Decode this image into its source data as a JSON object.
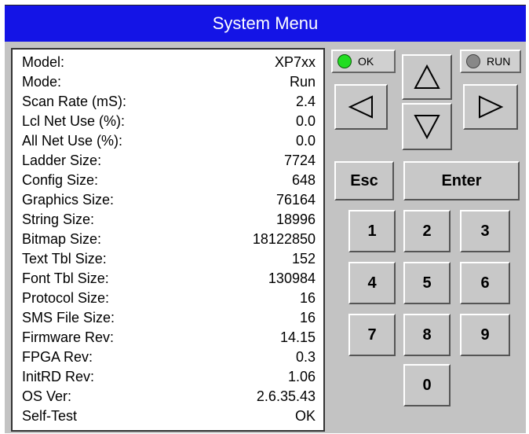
{
  "window": {
    "title": "System Menu"
  },
  "info": {
    "rows": [
      {
        "label": "Model:",
        "value": "XP7xx"
      },
      {
        "label": "Mode:",
        "value": "Run"
      },
      {
        "label": "Scan Rate (mS):",
        "value": "2.4"
      },
      {
        "label": "Lcl Net Use (%):",
        "value": "0.0"
      },
      {
        "label": "All Net Use (%):",
        "value": "0.0"
      },
      {
        "label": "Ladder Size:",
        "value": "7724"
      },
      {
        "label": "Config Size:",
        "value": "648"
      },
      {
        "label": "Graphics Size:",
        "value": "76164"
      },
      {
        "label": "String Size:",
        "value": "18996"
      },
      {
        "label": "Bitmap Size:",
        "value": "18122850"
      },
      {
        "label": "Text Tbl Size:",
        "value": "152"
      },
      {
        "label": "Font Tbl Size:",
        "value": "130984"
      },
      {
        "label": "Protocol Size:",
        "value": "16"
      },
      {
        "label": "SMS File Size:",
        "value": "16"
      },
      {
        "label": "Firmware Rev:",
        "value": "14.15"
      },
      {
        "label": "FPGA Rev:",
        "value": "0.3"
      },
      {
        "label": "InitRD Rev:",
        "value": "1.06"
      },
      {
        "label": "OS Ver:",
        "value": "2.6.35.43"
      },
      {
        "label": "Self-Test",
        "value": "OK"
      }
    ]
  },
  "indicators": {
    "ok": {
      "label": "OK",
      "color": "#22dd22"
    },
    "run": {
      "label": "RUN",
      "color": "#888888"
    }
  },
  "keypad": {
    "esc": "Esc",
    "enter": "Enter",
    "k1": "1",
    "k2": "2",
    "k3": "3",
    "k4": "4",
    "k5": "5",
    "k6": "6",
    "k7": "7",
    "k8": "8",
    "k9": "9",
    "k0": "0"
  },
  "icons": {
    "up": "arrow-up-icon",
    "down": "arrow-down-icon",
    "left": "arrow-left-icon",
    "right": "arrow-right-icon"
  },
  "colors": {
    "title_bar": "#1414e6",
    "panel": "#c3c3c3"
  }
}
